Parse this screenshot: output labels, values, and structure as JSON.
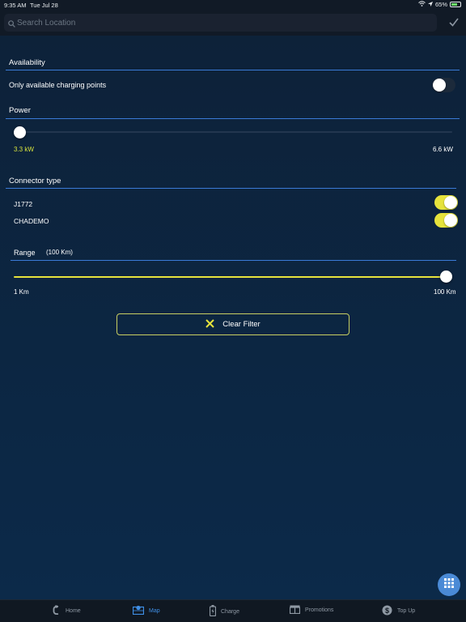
{
  "status_bar": {
    "time": "9:35 AM",
    "date": "Tue Jul 28",
    "battery": "65%",
    "battery_level": 0.65
  },
  "search": {
    "placeholder": "Search Location",
    "confirm_icon": "checkmark-icon",
    "search_icon": "magnifier-icon"
  },
  "availability": {
    "title": "Availability",
    "toggle_label": "Only available charging points",
    "toggle_on": false
  },
  "power": {
    "title": "Power",
    "min_label": "3.3 kW",
    "max_label": "6.6 kW",
    "value_kw": 3.3
  },
  "connector": {
    "title": "Connector type",
    "items": [
      {
        "label": "J1772",
        "on": true
      },
      {
        "label": "CHADEMO",
        "on": true
      }
    ]
  },
  "range": {
    "title": "Range",
    "value_label": "(100 Km)",
    "min_label": "1 Km",
    "max_label": "100 Km",
    "value_km": 100
  },
  "clear_filter": {
    "label": "Clear Filter",
    "icon": "close-x-icon"
  },
  "fab_icon": "grid-icon",
  "tabs": [
    {
      "label": "Home",
      "icon": "home-icon",
      "active": false
    },
    {
      "label": "Map",
      "icon": "map-icon",
      "active": true
    },
    {
      "label": "Charge",
      "icon": "charge-icon",
      "active": false
    },
    {
      "label": "Promotions",
      "icon": "promotions-icon",
      "active": false
    },
    {
      "label": "Top Up",
      "icon": "dollar-icon",
      "active": false
    }
  ],
  "colors": {
    "accent_blue": "#3a7ad6",
    "toggle_on": "#e6e33c",
    "power_min_label": "#d6e23c",
    "active_tab": "#3f8fe6"
  }
}
